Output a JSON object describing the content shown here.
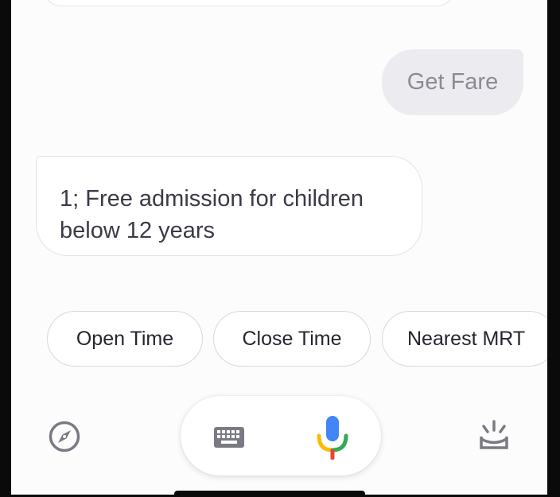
{
  "conversation": {
    "user_message": "Get Fare",
    "assistant_reply_line1": "1; Free admission for children",
    "assistant_reply_line2": "below 12 years"
  },
  "suggestions": [
    {
      "label": "Open Time"
    },
    {
      "label": "Close Time"
    },
    {
      "label": "Nearest MRT"
    }
  ],
  "bottom_bar": {
    "icons": [
      "compass-icon",
      "keyboard-icon",
      "microphone-icon",
      "updates-icon"
    ]
  },
  "colors": {
    "mic_blue": "#4285F4",
    "mic_red": "#EA4335",
    "mic_yellow": "#FBBC05",
    "mic_green": "#34A853",
    "icon_gray": "#7a7a84"
  }
}
